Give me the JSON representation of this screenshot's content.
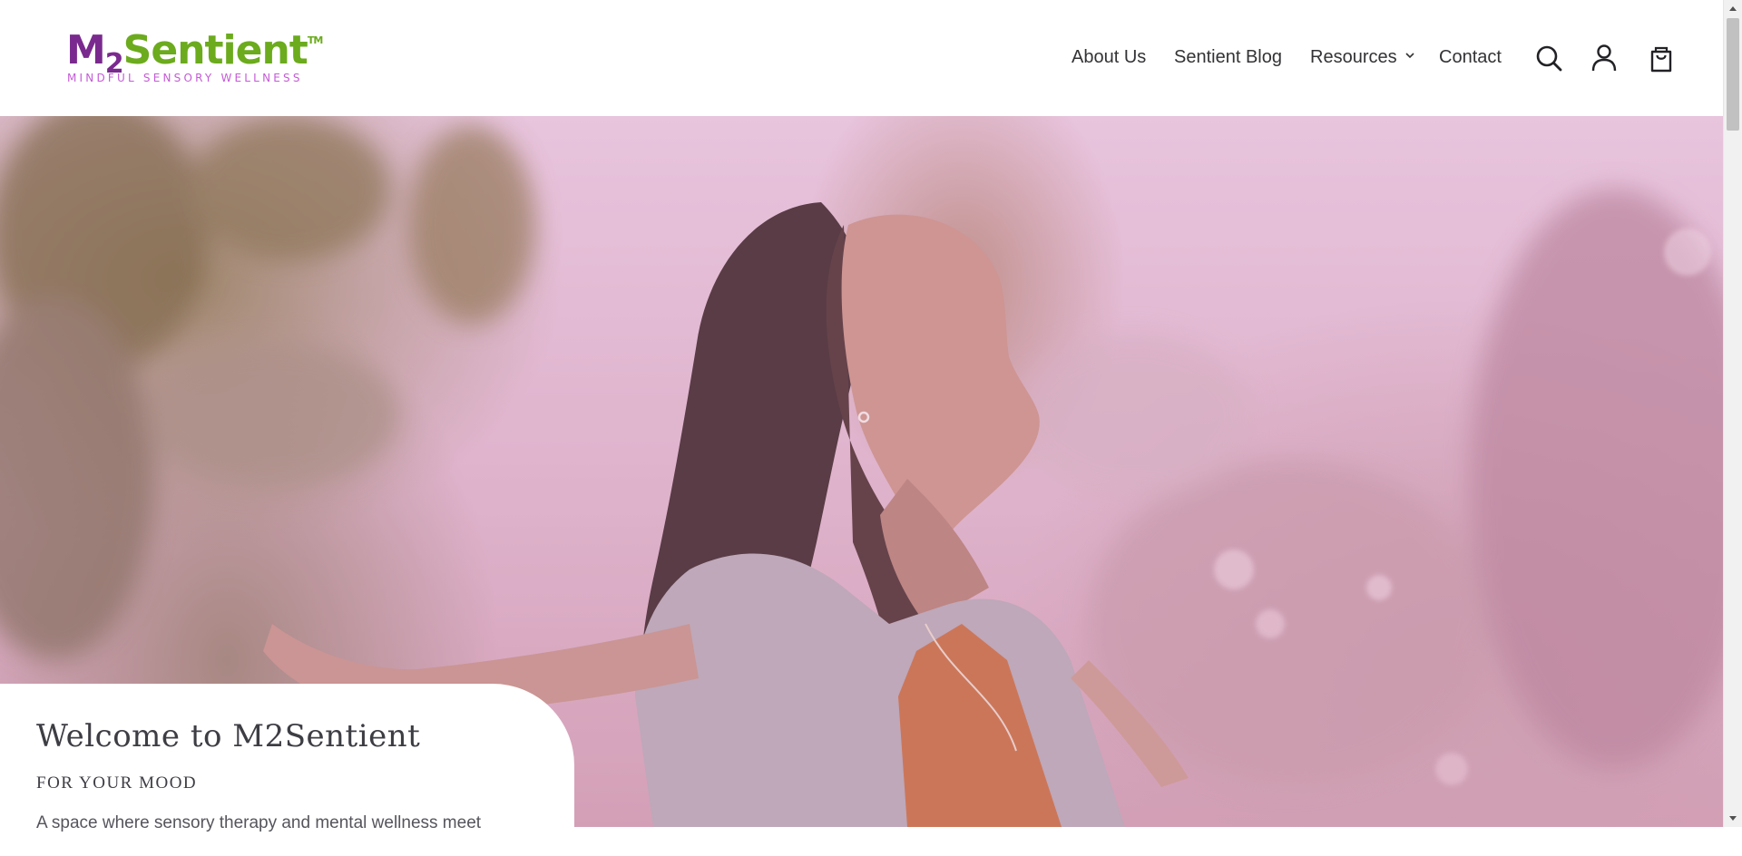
{
  "brand": {
    "logo_text": "M2Sentient",
    "logo_m": "M",
    "logo_2": "2",
    "logo_sentient": "Sentient",
    "logo_tm": "TM",
    "tagline": "MINDFUL SENSORY WELLNESS",
    "colors": {
      "purple": "#7a2a8e",
      "green": "#6bab1d",
      "magenta": "#c45bd6"
    }
  },
  "nav": {
    "items": [
      {
        "label": "About Us"
      },
      {
        "label": "Sentient Blog"
      },
      {
        "label": "Resources",
        "has_dropdown": true
      },
      {
        "label": "Contact"
      }
    ],
    "icons": {
      "search": "search-icon",
      "account": "account-icon",
      "cart": "cart-icon",
      "dropdown": "chevron-down-icon"
    }
  },
  "hero": {
    "image": "woman-arms-outstretched-eyes-closed-pink-tint",
    "tint_color": "#e8b0d8"
  },
  "welcome_card": {
    "title": "Welcome to M2Sentient",
    "subtitle": "FOR YOUR MOOD",
    "body": "A space where sensory therapy and mental wellness meet"
  },
  "scrollbar": {
    "up_icon": "scroll-up-arrow-icon",
    "down_icon": "scroll-down-arrow-icon"
  }
}
